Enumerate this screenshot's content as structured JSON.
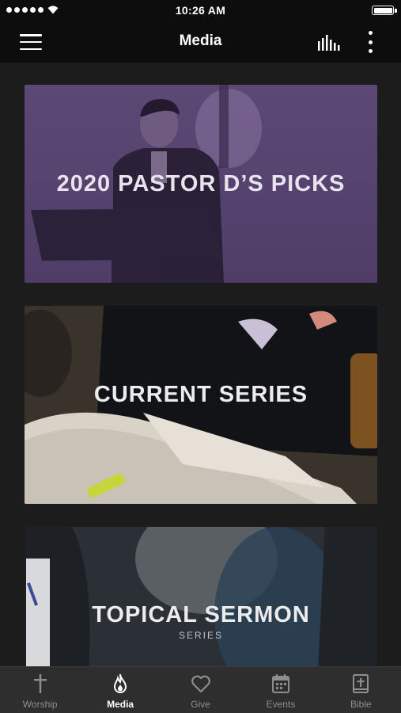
{
  "status_bar": {
    "time": "10:26 AM"
  },
  "nav": {
    "title": "Media"
  },
  "cards": [
    {
      "title": "2020 PASTOR D’S PICKS",
      "subtitle": ""
    },
    {
      "title": "CURRENT SERIES",
      "subtitle": ""
    },
    {
      "title": "TOPICAL SERMON",
      "subtitle": "SERIES"
    }
  ],
  "tabs": [
    {
      "label": "Worship",
      "icon": "cross-icon",
      "active": false
    },
    {
      "label": "Media",
      "icon": "flame-icon",
      "active": true
    },
    {
      "label": "Give",
      "icon": "heart-icon",
      "active": false
    },
    {
      "label": "Events",
      "icon": "calendar-icon",
      "active": false
    },
    {
      "label": "Bible",
      "icon": "bible-icon",
      "active": false
    }
  ],
  "colors": {
    "active_tab": "#ffffff",
    "inactive_tab": "#8e8e8e",
    "card_1_tint": "#5c4875"
  }
}
